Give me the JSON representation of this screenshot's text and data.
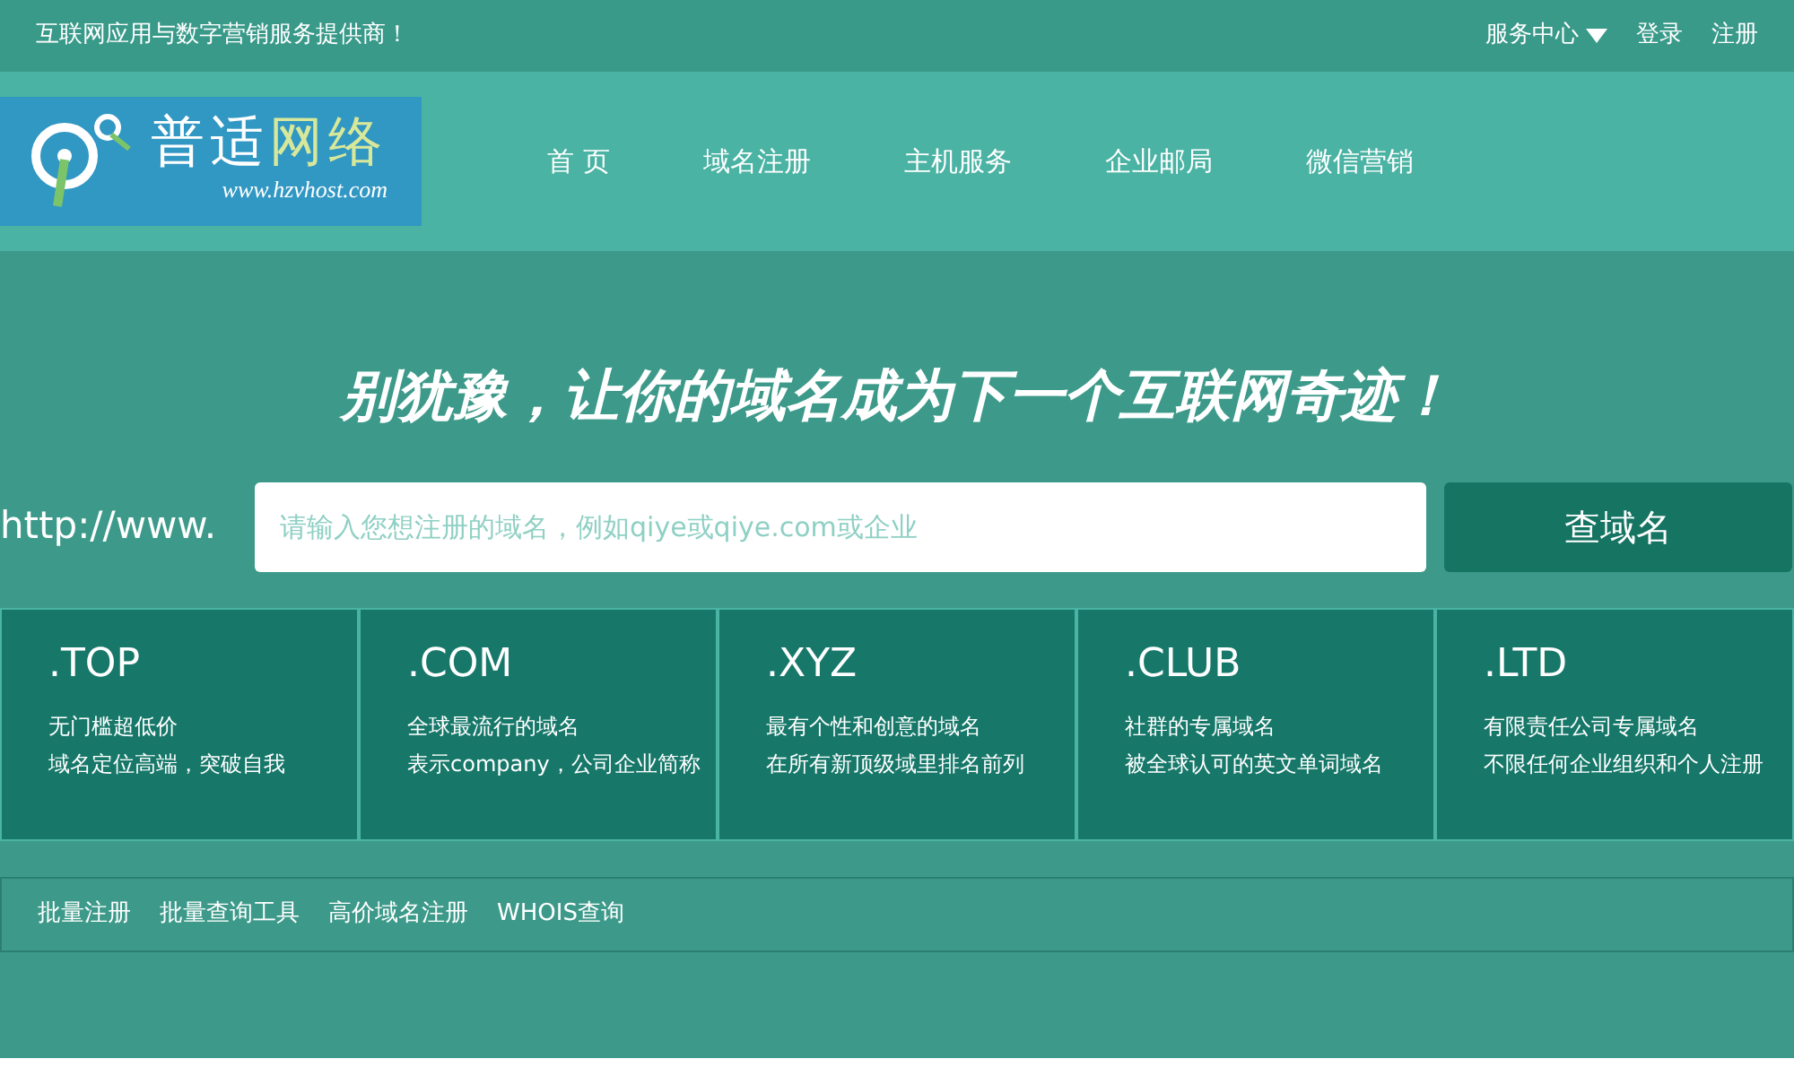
{
  "top_bar": {
    "tagline": "互联网应用与数字营销服务提供商！",
    "links": [
      {
        "label": "服务中心",
        "kind": "dropdown"
      },
      {
        "label": "登录",
        "kind": "link"
      },
      {
        "label": "注册",
        "kind": "link"
      }
    ]
  },
  "header": {
    "logo": {
      "title_left": "普适",
      "title_right": "网络",
      "url": "www.hzvhost.com"
    },
    "nav": [
      {
        "label": "首 页"
      },
      {
        "label": "域名注册"
      },
      {
        "label": "主机服务"
      },
      {
        "label": "企业邮局"
      },
      {
        "label": "微信营销"
      }
    ]
  },
  "hero": {
    "slogan": "别犹豫，让你的域名成为下一个互联网奇迹！",
    "prefix": "http://www.",
    "search": {
      "placeholder": "请输入您想注册的域名，例如qiye或qiye.com或企业"
    },
    "button": "查域名"
  },
  "domains": [
    {
      "name": ".TOP",
      "lines": [
        "无门槛超低价",
        "域名定位高端，突破自我"
      ]
    },
    {
      "name": ".COM",
      "lines": [
        "全球最流行的域名",
        "表示company，公司企业简称"
      ]
    },
    {
      "name": ".XYZ",
      "lines": [
        "最有个性和创意的域名",
        "在所有新顶级域里排名前列"
      ]
    },
    {
      "name": ".CLUB",
      "lines": [
        "社群的专属域名",
        "被全球认可的英文单词域名"
      ]
    },
    {
      "name": ".LTD",
      "lines": [
        "有限责任公司专属域名",
        "不限任何企业组织和个人注册"
      ]
    }
  ],
  "tools": [
    "批量注册",
    "批量查询工具",
    "高价域名注册",
    "WHOIS查询"
  ]
}
